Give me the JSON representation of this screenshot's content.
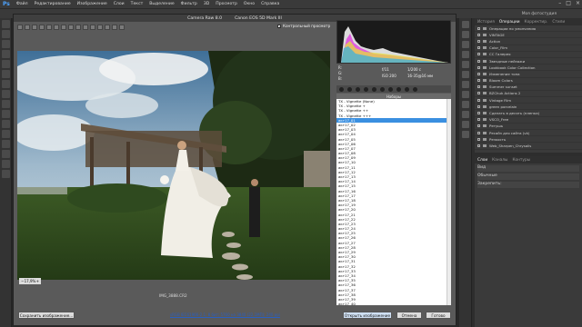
{
  "photoshop": {
    "logo": "Ps",
    "menu": [
      "Файл",
      "Редактирование",
      "Изображение",
      "Слои",
      "Текст",
      "Выделение",
      "Фильтр",
      "3D",
      "Просмотр",
      "Окно",
      "Справка"
    ],
    "workspace": "Моя фотостудия",
    "right_tabs": [
      "История",
      "Операции",
      "Корректир.",
      "Стили"
    ],
    "actions": [
      "Операции по умолчанию",
      "VINTAGE",
      "Action",
      "Color_Film",
      "CC Галерея",
      "Звездные пейзажи",
      "Lookbook Color Collection",
      "Изменение тона",
      "Bloom Colors",
      "Summer sunset",
      "BZChuk Actions 2",
      "Vintage Film",
      "green porcelain",
      "Сделать в десять (пленка)",
      "VSCO_Free",
      "Ретушь",
      "Ресайз для сайта (vk)",
      "Резкость",
      "Web_Sharpen_Chrysalis"
    ],
    "layers_tabs": [
      "Слои",
      "Каналы",
      "Контуры"
    ],
    "layers_controls": [
      "Вид",
      "Обычные",
      "Закрепить:"
    ]
  },
  "acr": {
    "title": "Camera Raw 8.0",
    "camera": "Canon EOS 5D Mark III",
    "preview_label": "Контрольный просмотр",
    "preview_checked": "✓",
    "zoom": "17,9%",
    "file_name": "IMG_3888.CR2",
    "cam_info": {
      "r": "R:",
      "g": "G:",
      "b": "B:",
      "aperture": "f/11",
      "shutter": "1/200 с",
      "iso": "ISO 200",
      "lens": "16-35@16 мм"
    },
    "presets_header": "Наборы",
    "presets": [
      "TX - Vignette (None)",
      "TX - Vignette +",
      "TX - Vignette ++",
      "TX - Vignette +++",
      "акт17_01",
      "акт17_02",
      "акт17_03",
      "акт17_04",
      "акт17_05",
      "акт17_06",
      "акт17_07",
      "акт17_08",
      "акт17_09",
      "акт17_10",
      "акт17_11",
      "акт17_12",
      "акт17_13",
      "акт17_14",
      "акт17_15",
      "акт17_16",
      "акт17_17",
      "акт17_18",
      "акт17_19",
      "акт17_20",
      "акт17_21",
      "акт17_22",
      "акт17_23",
      "акт17_24",
      "акт17_25",
      "акт17_26",
      "акт17_27",
      "акт17_28",
      "акт17_29",
      "акт17_30",
      "акт17_31",
      "акт17_32",
      "акт17_33",
      "акт17_34",
      "акт17_35",
      "акт17_36",
      "акт17_37",
      "акт17_38",
      "акт17_39",
      "акт17_40"
    ],
    "selected_preset_index": 4,
    "save_button": "Сохранить изображение...",
    "workflow_link": "sRGB IEC61966-2.1; 8 бит; 5760 на 3840 (22,1МП); 240 ppi",
    "open_button": "Открыть изображение",
    "cancel_button": "Отмена",
    "done_button": "Готово",
    "toolbar_icons": [
      "zoom-icon",
      "hand-icon",
      "white-balance-icon",
      "color-sampler-icon",
      "target-adjust-icon",
      "crop-icon",
      "straighten-icon",
      "spot-removal-icon",
      "red-eye-icon",
      "adjustment-brush-icon",
      "graduated-filter-icon",
      "radial-filter-icon",
      "preferences-icon",
      "rotate-left-icon",
      "rotate-right-icon"
    ]
  }
}
